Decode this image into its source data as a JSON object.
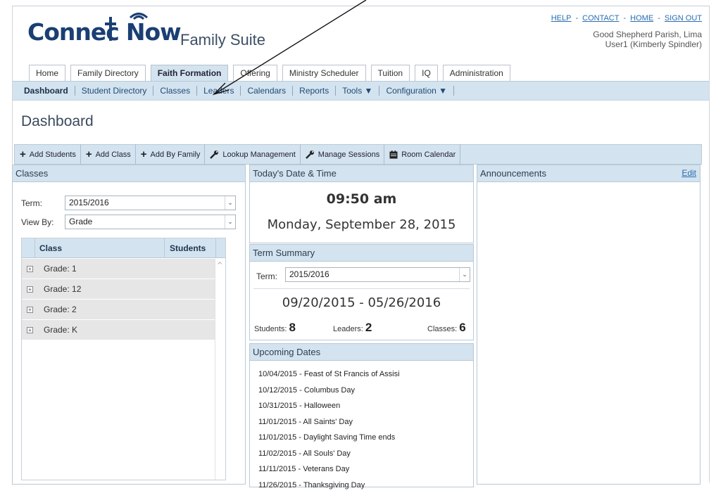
{
  "header": {
    "logo_text": "ConnectNow",
    "suite_title": "Family Suite",
    "links": [
      "HELP",
      "CONTACT",
      "HOME",
      "SIGN OUT"
    ],
    "parish": "Good Shepherd Parish, Lima",
    "user": "User1 (Kimberly Spindler)"
  },
  "tabs": [
    "Home",
    "Family Directory",
    "Faith Formation",
    "Offering",
    "Ministry Scheduler",
    "Tuition",
    "IQ",
    "Administration"
  ],
  "active_tab": "Faith Formation",
  "subnav": [
    "Dashboard",
    "Student Directory",
    "Classes",
    "Leaders",
    "Calendars",
    "Reports",
    "Tools ▼",
    "Configuration ▼"
  ],
  "page_title": "Dashboard",
  "toolbar": {
    "add_students": "Add Students",
    "add_class": "Add Class",
    "add_by_family": "Add By Family",
    "lookup_management": "Lookup Management",
    "manage_sessions": "Manage Sessions",
    "room_calendar": "Room Calendar"
  },
  "classes": {
    "title": "Classes",
    "term_label": "Term:",
    "term_value": "2015/2016",
    "viewby_label": "View By:",
    "viewby_value": "Grade",
    "col_class": "Class",
    "col_students": "Students",
    "rows": [
      "Grade: 1",
      "Grade: 12",
      "Grade: 2",
      "Grade: K"
    ]
  },
  "datetime": {
    "title": "Today's Date & Time",
    "time": "09:50 am",
    "date": "Monday, September 28, 2015"
  },
  "term_summary": {
    "title": "Term Summary",
    "term_label": "Term:",
    "term_value": "2015/2016",
    "range": "09/20/2015 - 05/26/2016",
    "students_label": "Students:",
    "students": "8",
    "leaders_label": "Leaders:",
    "leaders": "2",
    "classes_label": "Classes:",
    "classes": "6"
  },
  "upcoming": {
    "title": "Upcoming Dates",
    "items": [
      "10/04/2015 - Feast of St Francis of Assisi",
      "10/12/2015 - Columbus Day",
      "10/31/2015 - Halloween",
      "11/01/2015 - All Saints' Day",
      "11/01/2015 - Daylight Saving Time ends",
      "11/02/2015 - All Souls' Day",
      "11/11/2015 - Veterans Day",
      "11/26/2015 - Thanksgiving Day"
    ]
  },
  "announcements": {
    "title": "Announcements",
    "edit": "Edit"
  },
  "colors": {
    "accent_bg": "#d3e3ef",
    "link": "#2a6db0",
    "brand": "#1a3f73"
  }
}
